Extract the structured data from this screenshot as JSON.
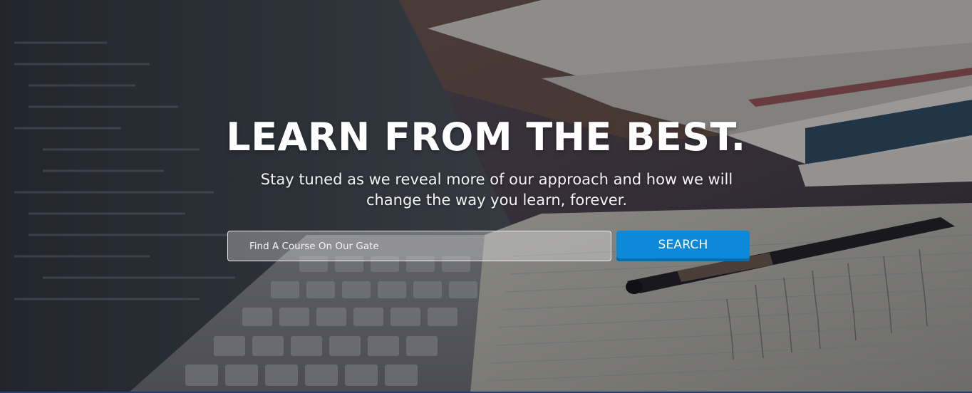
{
  "hero": {
    "headline": "LEARN FROM THE BEST.",
    "subtitle": "Stay tuned as we reveal more of our approach and how we will change the way you learn, forever."
  },
  "search": {
    "placeholder": "Find A Course On Our Gate",
    "value": "",
    "button_label": "SEARCH"
  },
  "colors": {
    "accent": "#0d89d9",
    "headline": "#ffffff"
  }
}
